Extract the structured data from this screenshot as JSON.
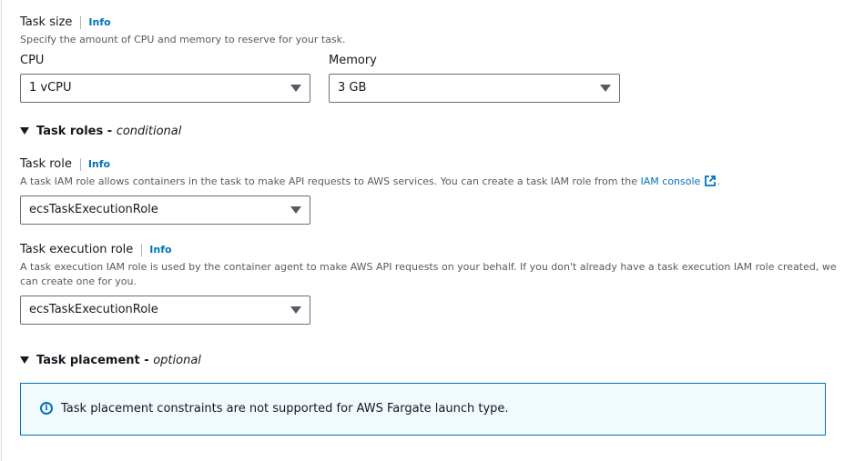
{
  "task_size": {
    "label": "Task size",
    "info": "Info",
    "description": "Specify the amount of CPU and memory to reserve for your task.",
    "cpu": {
      "label": "CPU",
      "value": "1 vCPU"
    },
    "memory": {
      "label": "Memory",
      "value": "3 GB"
    }
  },
  "task_roles": {
    "section_title": "Task roles - ",
    "section_qualifier": "conditional",
    "task_role": {
      "label": "Task role",
      "info": "Info",
      "description": "A task IAM role allows containers in the task to make API requests to AWS services. You can create a task IAM role from the ",
      "link_text": "IAM console",
      "description_end": ".",
      "value": "ecsTaskExecutionRole"
    },
    "execution_role": {
      "label": "Task execution role",
      "info": "Info",
      "description_line1": "A task execution IAM role is used by the container agent to make AWS API requests on your behalf. If you don't already have a task execution IAM role created, we",
      "description_line2": "can create one for you.",
      "value": "ecsTaskExecutionRole"
    }
  },
  "task_placement": {
    "section_title": "Task placement - ",
    "section_qualifier": "optional",
    "alert_text": "Task placement constraints are not supported for AWS Fargate launch type."
  },
  "colors": {
    "link": "#0073bb",
    "alert_bg": "#f1faff",
    "border": "#687078"
  },
  "icons": {
    "info": "info-circle-icon",
    "external": "external-link-icon",
    "dropdown": "caret-down-icon",
    "expand": "triangle-down-icon"
  }
}
